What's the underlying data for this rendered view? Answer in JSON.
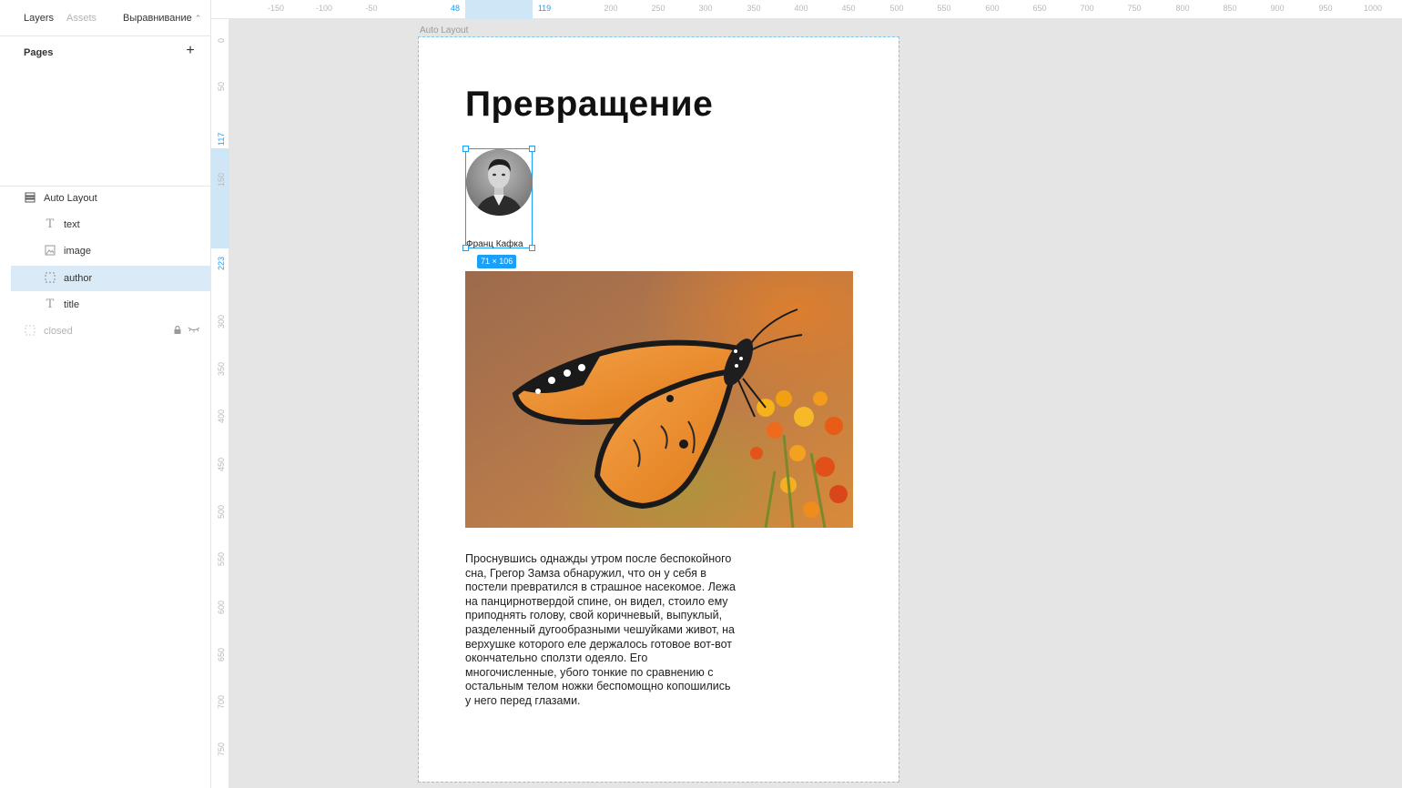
{
  "sidebar": {
    "tabs": {
      "layers": "Layers",
      "assets": "Assets",
      "align": "Выравнивание",
      "align_caret": "⌃"
    },
    "pages_title": "Pages",
    "add_page_symbol": "+",
    "layers": {
      "root": "Auto Layout",
      "text": "text",
      "image": "image",
      "author": "author",
      "title": "title",
      "closed": "closed"
    }
  },
  "rulers": {
    "x_ticks": [
      "-150",
      "-100",
      "-50",
      "48",
      "119",
      "200",
      "250",
      "300",
      "350",
      "400",
      "450",
      "500",
      "550",
      "600",
      "650",
      "700",
      "750",
      "800",
      "850",
      "900",
      "950",
      "1000"
    ],
    "y_ticks": [
      "0",
      "50",
      "117",
      "150",
      "223",
      "300",
      "350",
      "400",
      "450",
      "500",
      "550",
      "600",
      "650",
      "700",
      "750"
    ]
  },
  "canvas": {
    "frame_label": "Auto Layout",
    "title": "Превращение",
    "author_name": "Франц Кафка",
    "selection_size": "71 × 106",
    "body": "Проснувшись однажды утром после беспокойного сна, Грегор Замза обнаружил, что он у себя в постели превратился в страшное насекомое. Лежа на панцирнотвердой спине, он видел, стоило ему приподнять голову, свой коричневый, выпуклый, разделенный дугообразными чешуйками живот, на верхушке которого еле держалось готовое вот-вот окончательно сползти одеяло. Его многочисленные, убого тонкие по сравнению с остальным телом ножки беспомощно копошились у него перед глазами."
  },
  "colors": {
    "accent": "#18a0fb",
    "selected_row": "#daebf7",
    "canvas_bg": "#e5e5e5"
  }
}
